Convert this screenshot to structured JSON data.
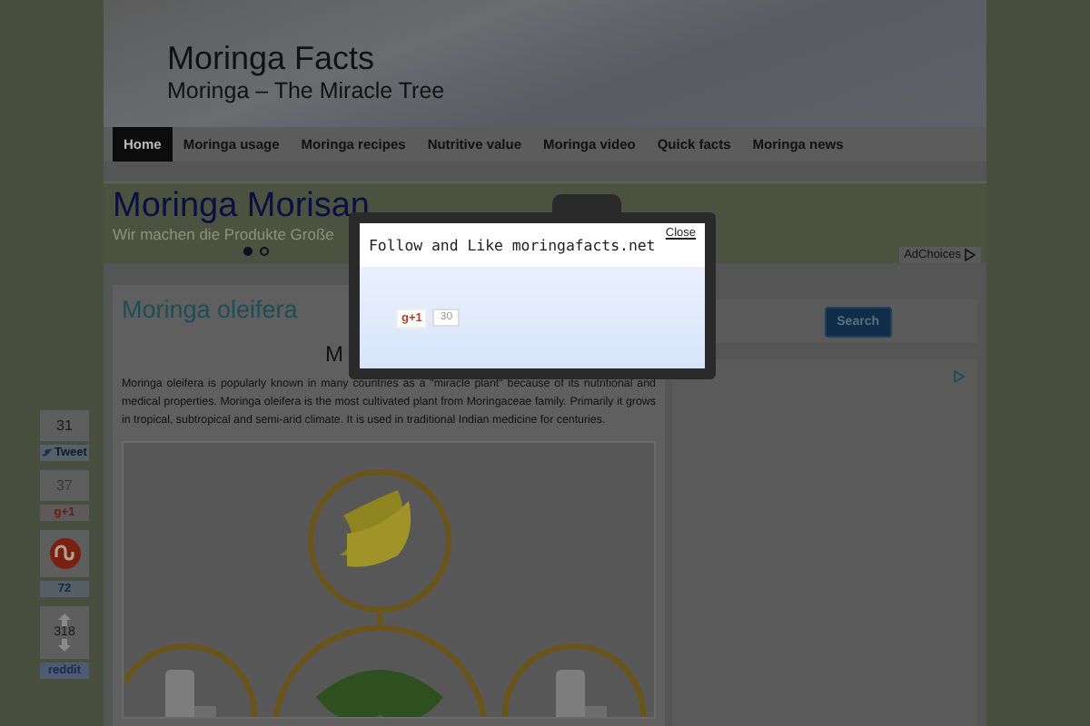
{
  "site": {
    "title": "Moringa Facts",
    "tagline": "Moringa – The Miracle Tree"
  },
  "nav": [
    {
      "label": "Home",
      "selected": true
    },
    {
      "label": "Moringa usage",
      "selected": false
    },
    {
      "label": "Moringa recipes",
      "selected": false
    },
    {
      "label": "Nutritive value",
      "selected": false
    },
    {
      "label": "Moringa video",
      "selected": false
    },
    {
      "label": "Quick facts",
      "selected": false
    },
    {
      "label": "Moringa news",
      "selected": false
    }
  ],
  "ad": {
    "title": "Moringa Morisan",
    "subtitle": "Wir machen die Produkte Große",
    "dots": [
      {
        "selected": true
      },
      {
        "selected": false
      }
    ],
    "adchoices": "AdChoices"
  },
  "post": {
    "title": "Moringa oleifera",
    "heading": "M",
    "body": "Moringa oleifera is popularly known in many countries as a \"miracle plant\" because of its nutritional and medical properties. Moringa oleifera is the most cultivated plant from Moringaceae family. Primarily it grows in tropical, subtropical and semi-arid climate. It is used in traditional Indian medicine for centuries."
  },
  "sidebar": {
    "search_button": "Search"
  },
  "share": [
    {
      "kind": "tweet",
      "count": "31",
      "label": "Tweet"
    },
    {
      "kind": "gplus",
      "count": "37",
      "label": "g+1"
    },
    {
      "kind": "stumble",
      "count": "72"
    },
    {
      "kind": "reddit",
      "count": "318",
      "label": "reddit"
    }
  ],
  "modal": {
    "title": "Follow and Like moringafacts.net",
    "close": "Close",
    "gplus": {
      "label": "g+1",
      "count": "30"
    }
  }
}
